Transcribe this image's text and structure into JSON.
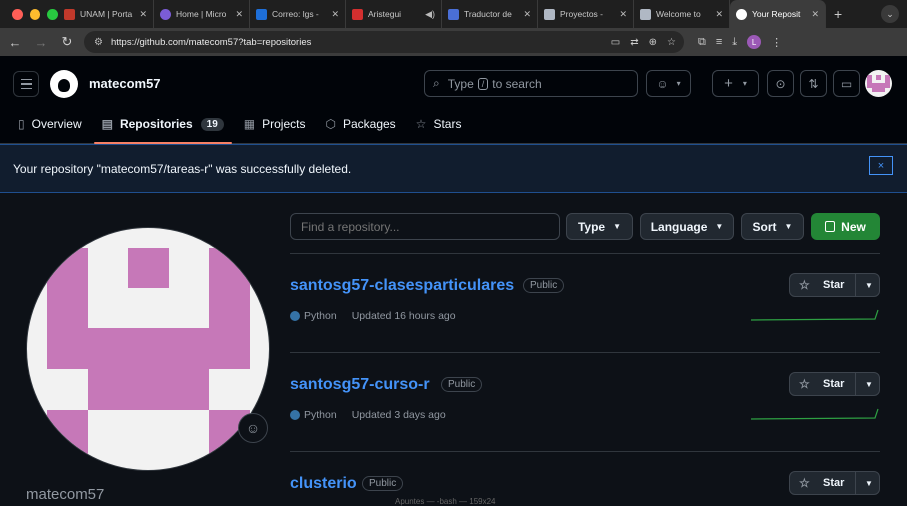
{
  "browser": {
    "tabs": [
      {
        "label": "UNAM | Porta",
        "color": "#c0392b"
      },
      {
        "label": "Home | Micro",
        "color": "#7b5cd6"
      },
      {
        "label": "Correo: lgs -",
        "color": "#1e6fd9"
      },
      {
        "label": "Aristegui",
        "color": "#d32f2f"
      },
      {
        "label": "Traductor de",
        "color": "#4a6fd6"
      },
      {
        "label": "Proyectos -",
        "color": "#b0b8c4"
      },
      {
        "label": "Welcome to",
        "color": "#b0b8c4"
      },
      {
        "label": "Your Reposit",
        "color": "#ffffff"
      }
    ],
    "url": "https://github.com/matecom57?tab=repositories",
    "profile_initial": "L"
  },
  "header": {
    "username": "matecom57",
    "search_pre": "Type",
    "search_key": "/",
    "search_post": "to search"
  },
  "subnav": {
    "items": [
      {
        "label": "Overview",
        "icon": "book-icon"
      },
      {
        "label": "Repositories",
        "icon": "repo-icon",
        "count": "19"
      },
      {
        "label": "Projects",
        "icon": "table-icon"
      },
      {
        "label": "Packages",
        "icon": "package-icon"
      },
      {
        "label": "Stars",
        "icon": "star-icon"
      }
    ]
  },
  "flash": {
    "message": "Your repository \"matecom57/tareas-r\" was successfully deleted.",
    "close": "×"
  },
  "profile": {
    "name": "matecom57"
  },
  "filters": {
    "placeholder": "Find a repository...",
    "type": "Type",
    "language": "Language",
    "sort": "Sort",
    "new": "New"
  },
  "repos": [
    {
      "name": "santosg57-clasesparticulares",
      "visibility": "Public",
      "language": "Python",
      "updated": "Updated 16 hours ago",
      "star": "Star"
    },
    {
      "name": "santosg57-curso-r",
      "visibility": "Public",
      "language": "Python",
      "updated": "Updated 3 days ago",
      "star": "Star"
    },
    {
      "name": "clusterio",
      "visibility": "Public",
      "star": "Star"
    }
  ],
  "colors": {
    "accent": "#4493f8",
    "new_button": "#238636",
    "tab_underline": "#f78166",
    "avatar": "#c678b8",
    "python": "#3572a5"
  },
  "background_text": "Apuntes — -bash — 159x24"
}
